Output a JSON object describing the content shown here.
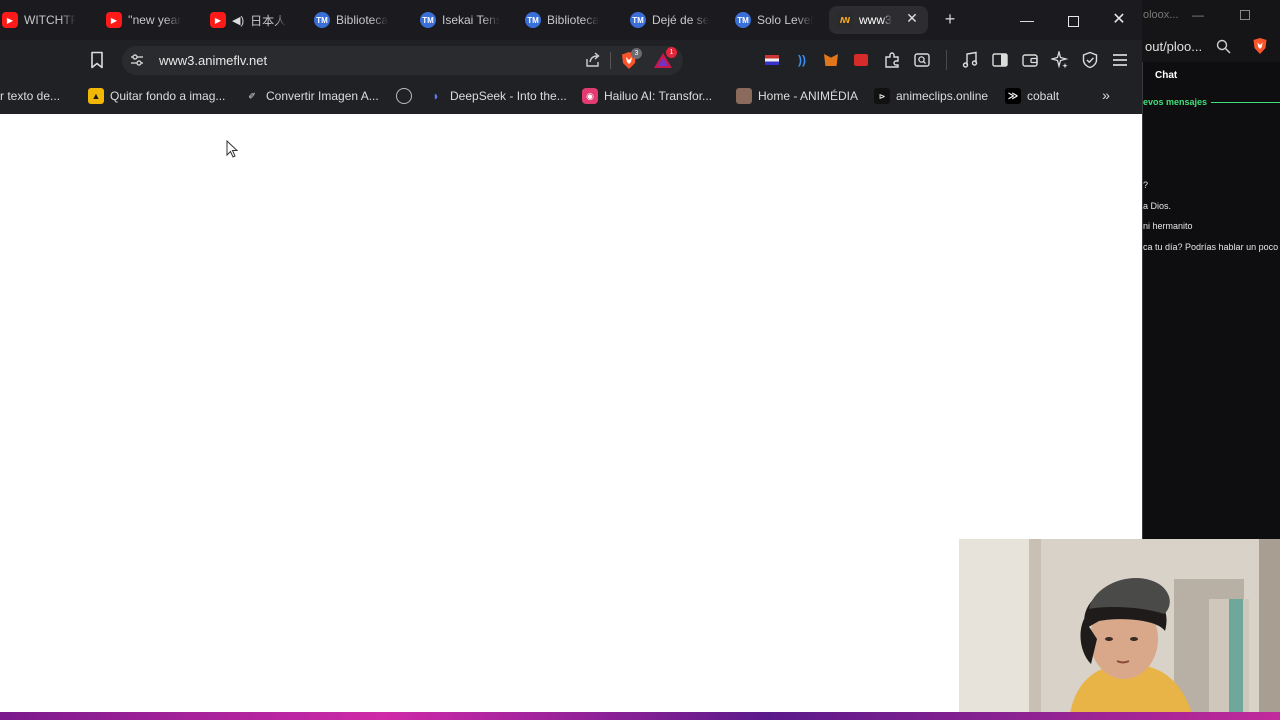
{
  "browser": {
    "tabs": [
      {
        "label": "WITCHTR",
        "icon": "youtube-icon"
      },
      {
        "label": "''new year",
        "icon": "youtube-icon"
      },
      {
        "label": "日本人",
        "icon": "youtube-icon",
        "audio": "speaker-icon"
      },
      {
        "label": "Biblioteca",
        "icon": "tmo-icon"
      },
      {
        "label": "Isekai Tens",
        "icon": "tmo-icon"
      },
      {
        "label": "Biblioteca",
        "icon": "tmo-icon"
      },
      {
        "label": "Dejé de se",
        "icon": "tmo-icon"
      },
      {
        "label": "Solo Level",
        "icon": "tmo-icon"
      },
      {
        "label": "www3",
        "icon": "animeflv-icon",
        "active": true
      }
    ],
    "toolbar": {
      "url": "www3.animeflv.net",
      "brave_shield_badge": "3",
      "rewards_badge": "1"
    },
    "bookmarks": [
      {
        "label": "r texto de...",
        "icon": ""
      },
      {
        "label": "Quitar fondo a imag...",
        "icon": "graduation-cap-icon"
      },
      {
        "label": "Convertir Imagen A...",
        "icon": "convert-icon"
      },
      {
        "label": "",
        "icon": "globe-icon"
      },
      {
        "label": "DeepSeek - Into the...",
        "icon": "deepseek-icon"
      },
      {
        "label": "Hailuo AI: Transfor...",
        "icon": "hailuo-icon"
      },
      {
        "label": "Home - ANIMÉDIA",
        "icon": "animedia-icon"
      },
      {
        "label": "animeclips.online",
        "icon": "animeclips-icon"
      },
      {
        "label": "cobalt",
        "icon": "cobalt-icon"
      }
    ]
  },
  "side_window": {
    "tab_text": "oloox...",
    "url": "out/ploo...",
    "chat": {
      "title": "Chat",
      "new_messages_label": "evos mensajes",
      "messages": [
        "?",
        "a Dios.",
        "ni hermanito",
        "ca tu día? Podrías hablar un poco"
      ]
    }
  },
  "colors": {
    "chrome_dark": "#202124",
    "tabbar": "#1b1b1f",
    "new_messages_green": "#3fe07a",
    "page_bg": "#ffffff",
    "brave_orange": "#fb542b"
  }
}
